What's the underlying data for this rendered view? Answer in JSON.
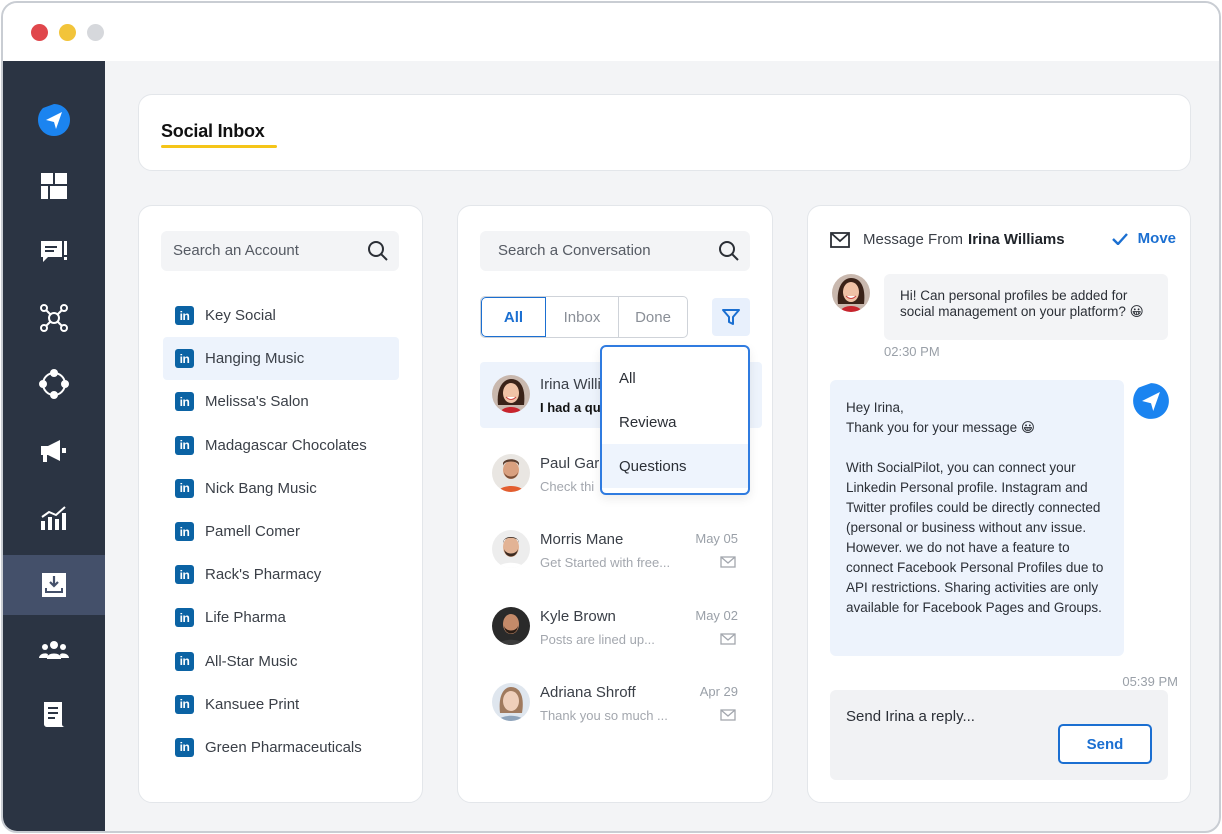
{
  "window": {
    "controls": [
      "close",
      "minimize",
      "maximize"
    ]
  },
  "sidebar": {
    "items": [
      {
        "icon": "paper-plane-logo-icon",
        "active": false
      },
      {
        "icon": "dashboard-icon",
        "active": false
      },
      {
        "icon": "comment-icon",
        "active": false
      },
      {
        "icon": "network-icon",
        "active": false
      },
      {
        "icon": "circle-nodes-icon",
        "active": false
      },
      {
        "icon": "megaphone-icon",
        "active": false
      },
      {
        "icon": "analytics-icon",
        "active": false
      },
      {
        "icon": "inbox-tray-icon",
        "active": true
      },
      {
        "icon": "users-icon",
        "active": false
      },
      {
        "icon": "document-icon",
        "active": false
      }
    ]
  },
  "header": {
    "title": "Social Inbox"
  },
  "accounts": {
    "search_placeholder": "Search an Account",
    "items": [
      {
        "name": "Key Social",
        "active": false
      },
      {
        "name": "Hanging Music",
        "active": true
      },
      {
        "name": "Melissa's Salon",
        "active": false
      },
      {
        "name": "Madagascar Chocolates",
        "active": false
      },
      {
        "name": "Nick Bang Music",
        "active": false
      },
      {
        "name": "Pamell Comer",
        "active": false
      },
      {
        "name": "Rack's Pharmacy",
        "active": false
      },
      {
        "name": "Life Pharma",
        "active": false
      },
      {
        "name": "All-Star Music",
        "active": false
      },
      {
        "name": "Kansuee Print",
        "active": false
      },
      {
        "name": "Green Pharmaceuticals",
        "active": false
      }
    ],
    "network_icon_label": "in"
  },
  "conversations": {
    "search_placeholder": "Search a Conversation",
    "tabs": [
      {
        "label": "All"
      },
      {
        "label": "Inbox"
      },
      {
        "label": "Done"
      }
    ],
    "active_tab": "All",
    "items": [
      {
        "name": "Irina Willi",
        "snippet": "I had a qu",
        "date": "",
        "unread": true
      },
      {
        "name": "Paul Gar",
        "snippet": "Check thi",
        "date": "",
        "unread": false
      },
      {
        "name": "Morris Mane",
        "snippet": "Get Started with free...",
        "date": "May 05",
        "unread": false
      },
      {
        "name": "Kyle Brown",
        "snippet": "Posts are lined up...",
        "date": "May 02",
        "unread": false
      },
      {
        "name": "Adriana Shroff",
        "snippet": "Thank you so much ...",
        "date": "Apr 29",
        "unread": false
      }
    ],
    "filter_menu": {
      "options": [
        {
          "label": "All"
        },
        {
          "label": "Reviewa"
        },
        {
          "label": "Questions"
        }
      ],
      "hovered": "Questions"
    }
  },
  "message": {
    "header_prefix": "Message From",
    "sender": "Irina Williams",
    "move_label": "Move",
    "incoming": {
      "text": "Hi! Can personal profiles be added for social management on your platform? 😀",
      "time": "02:30 PM"
    },
    "outgoing": {
      "text": "Hey Irina,\nThank you for your message 😀\n\nWith SocialPilot, you can connect your Linkedin Personal profile. Instagram and Twitter profiles could be directly connected (personal or business without anv issue. However. we do not have a feature to connect Facebook Personal Profiles due to API restrictions. Sharing activities are only available for Facebook Pages and Groups.",
      "time": "05:39 PM"
    },
    "reply_placeholder": "Send Irina a reply...",
    "send_label": "Send"
  },
  "colors": {
    "accent": "#1b6fd1",
    "sidebar_bg": "#2b3443",
    "sidebar_active": "#44506a",
    "linkedin": "#0b63a4",
    "title_underline": "#f5c518",
    "selected_row": "#edf3fc"
  }
}
